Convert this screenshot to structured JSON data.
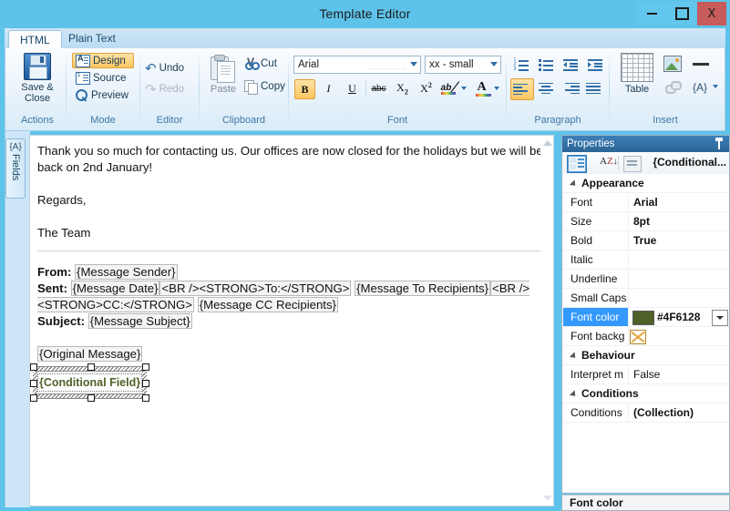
{
  "window": {
    "title": "Template Editor",
    "minimize_label": "Minimize",
    "maximize_label": "Maximize",
    "close_label": "X"
  },
  "tabs": [
    {
      "label": "HTML",
      "active": true
    },
    {
      "label": "Plain Text",
      "active": false
    }
  ],
  "ribbon": {
    "groups": [
      {
        "name": "Actions",
        "label": "Actions",
        "buttons": [
          {
            "label": "Save &\nClose",
            "label_line1": "Save &",
            "label_line2": "Close",
            "icon": "floppy-disk-icon"
          }
        ]
      },
      {
        "name": "Mode",
        "label": "Mode",
        "buttons": [
          {
            "label": "Design",
            "icon": "design-view-icon",
            "active": true
          },
          {
            "label": "Source",
            "icon": "source-view-icon",
            "active": false
          },
          {
            "label": "Preview",
            "icon": "magnifier-icon",
            "active": false
          }
        ]
      },
      {
        "name": "Editor",
        "label": "Editor",
        "buttons": [
          {
            "label": "Undo",
            "icon": "undo-arrow-icon",
            "enabled": true
          },
          {
            "label": "Redo",
            "icon": "redo-arrow-icon",
            "enabled": false
          }
        ]
      },
      {
        "name": "Clipboard",
        "label": "Clipboard",
        "buttons": [
          {
            "label": "Paste",
            "icon": "clipboard-icon"
          },
          {
            "label": "Cut",
            "icon": "scissors-icon"
          },
          {
            "label": "Copy",
            "icon": "copy-pages-icon"
          }
        ]
      },
      {
        "name": "Font",
        "label": "Font",
        "font_family": "Arial",
        "font_size": "xx - small",
        "buttons": [
          {
            "label": "B",
            "name": "bold",
            "active": true
          },
          {
            "label": "I",
            "name": "italic",
            "active": false
          },
          {
            "label": "U",
            "name": "underline",
            "active": false
          },
          {
            "label": "abc",
            "name": "strikethrough",
            "active": false
          },
          {
            "label": "X2",
            "name": "subscript",
            "active": false
          },
          {
            "label": "X2",
            "name": "superscript",
            "active": false
          },
          {
            "label": "ab",
            "name": "highlight-color",
            "active": false
          },
          {
            "label": "A",
            "name": "font-color",
            "active": false
          }
        ]
      },
      {
        "name": "Paragraph",
        "label": "Paragraph",
        "buttons": [
          {
            "name": "numbered-list"
          },
          {
            "name": "bulleted-list"
          },
          {
            "name": "decrease-indent"
          },
          {
            "name": "increase-indent"
          },
          {
            "name": "align-left",
            "active": true
          },
          {
            "name": "align-center"
          },
          {
            "name": "align-right"
          },
          {
            "name": "align-justify"
          }
        ]
      },
      {
        "name": "Insert",
        "label": "Insert",
        "buttons": [
          {
            "label": "Table",
            "name": "insert-table"
          },
          {
            "name": "insert-image"
          },
          {
            "name": "insert-horizontal-rule"
          },
          {
            "name": "insert-link"
          },
          {
            "label": "{A}",
            "name": "insert-field"
          }
        ]
      }
    ]
  },
  "side_tab": {
    "label": "Fields",
    "icon": "{A}"
  },
  "document": {
    "paragraph1": "Thank you so much for contacting us. Our offices are now closed for the holidays but we will be back on 2nd January!",
    "paragraph2": "Regards,",
    "paragraph3": "The Team",
    "from_label": "From:",
    "from_field": "{Message Sender}",
    "sent_label": "Sent:",
    "sent_field": "{Message Date}",
    "sent_markup_1": "<BR /><STRONG>To:</STRONG>",
    "to_field": "{Message To Recipients}",
    "sent_markup_2": "<BR /><STRONG>CC:</STRONG>",
    "cc_field": "{Message CC Recipients}",
    "subject_label": "Subject:",
    "subject_field": "{Message Subject}",
    "original_message_field": "{Original Message}",
    "conditional_field": "{Conditional Field}"
  },
  "properties": {
    "panel_title": "Properties",
    "pin_icon": "pin-icon",
    "toolbar": {
      "categorized_icon": "categorized-view-icon",
      "alphabetical_icon": "alphabetical-sort-icon",
      "pages_icon": "property-pages-icon",
      "selected_object": "{Conditional..."
    },
    "rows": [
      {
        "type": "category",
        "key": "Appearance"
      },
      {
        "type": "prop",
        "key": "Font",
        "value": "Arial"
      },
      {
        "type": "prop",
        "key": "Size",
        "value": "8pt"
      },
      {
        "type": "prop",
        "key": "Bold",
        "value": "True"
      },
      {
        "type": "prop",
        "key": "Italic",
        "value": ""
      },
      {
        "type": "prop",
        "key": "Underline",
        "value": ""
      },
      {
        "type": "prop",
        "key": "Small Caps",
        "value": ""
      },
      {
        "type": "color",
        "key": "Font color",
        "value": "#4F6128",
        "selected": true
      },
      {
        "type": "nocolor",
        "key": "Font backg",
        "value": ""
      },
      {
        "type": "category",
        "key": "Behaviour"
      },
      {
        "type": "prop",
        "key": "Interpret m",
        "value": "False"
      },
      {
        "type": "category",
        "key": "Conditions"
      },
      {
        "type": "prop",
        "key": "Conditions",
        "value": "(Collection)"
      }
    ]
  },
  "status_bar": {
    "text": "Font color"
  },
  "colors": {
    "titlebar": "#5ec3ea",
    "accent_blue": "#3399ff",
    "font_color_value": "#4F6128",
    "ribbon_highlight": "#fbc660"
  }
}
